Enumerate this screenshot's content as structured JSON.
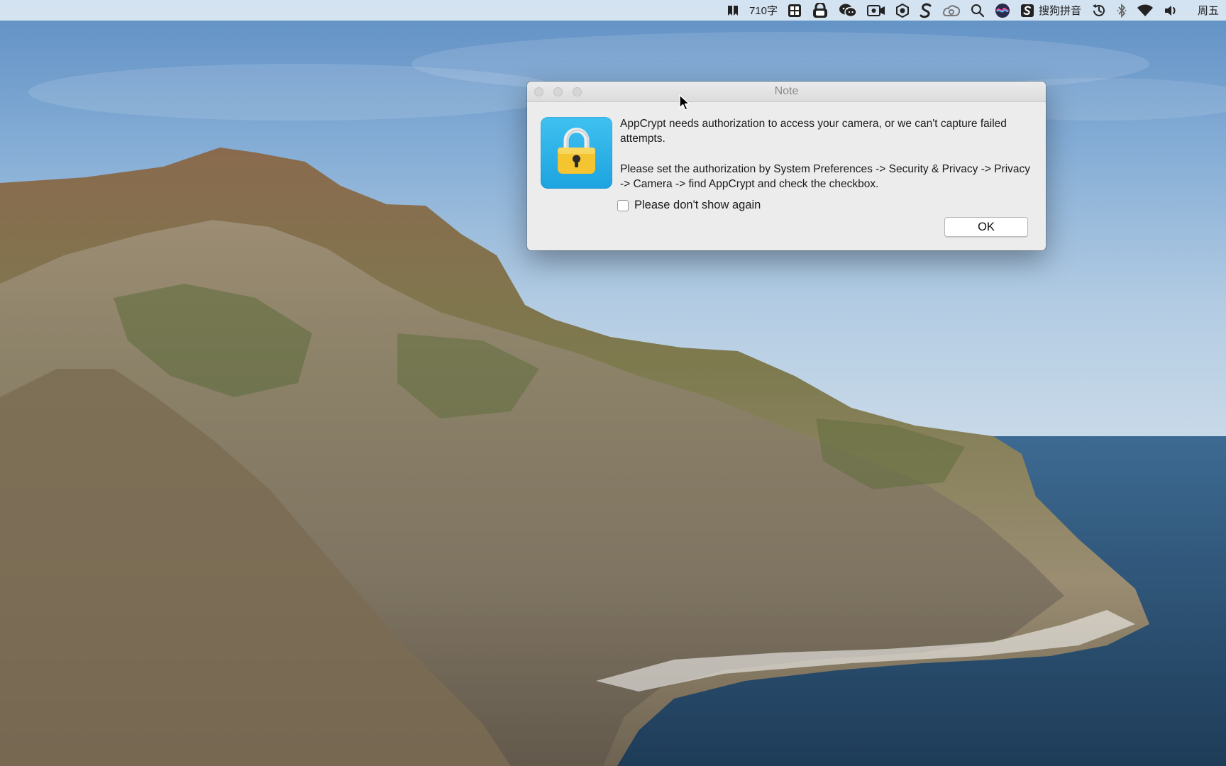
{
  "menubar": {
    "word_count": "710字",
    "input_method": "搜狗拼音",
    "day": "周五"
  },
  "dialog": {
    "title": "Note",
    "message_line1": "AppCrypt needs authorization to access your camera, or we can't capture failed attempts.",
    "message_line2": "Please set the authorization by System Preferences -> Security & Privacy -> Privacy -> Camera -> find AppCrypt and check the checkbox.",
    "checkbox_label": "Please don't show again",
    "checkbox_checked": false,
    "ok_label": "OK"
  },
  "colors": {
    "dialog_bg": "#ececec",
    "icon_blue": "#1da3df",
    "lock_yellow": "#f5c431"
  },
  "icons": {
    "app_icon": "padlock-icon"
  }
}
